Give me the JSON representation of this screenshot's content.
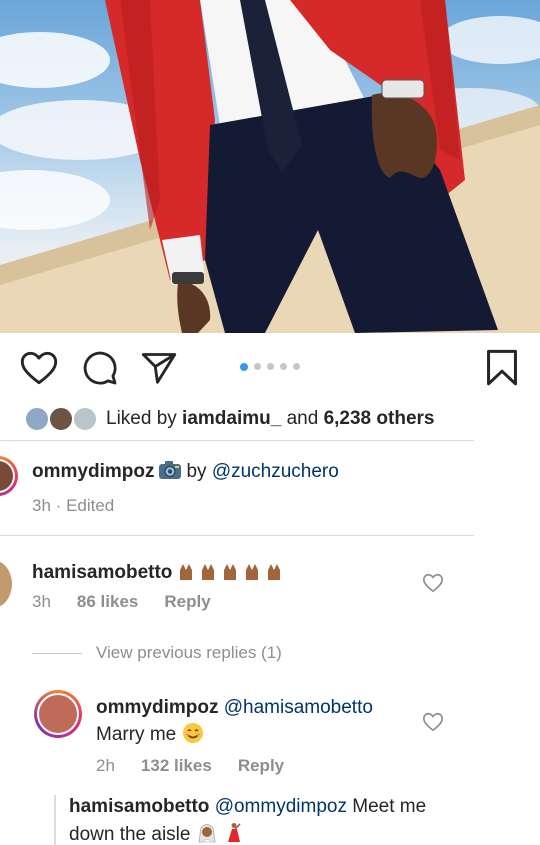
{
  "post": {
    "photo_alt": "",
    "carousel": {
      "count": 5,
      "active_index": 0
    }
  },
  "actions": {
    "like": "heart-icon",
    "comment": "comment-bubble-icon",
    "share": "paper-plane-icon",
    "save": "bookmark-icon"
  },
  "likes": {
    "prefix": "Liked by ",
    "first_user": "iamdaimu_",
    "middle": " and ",
    "others": "6,238 others"
  },
  "caption": {
    "username": "ommydimpoz",
    "camera_icon": "camera-emoji",
    "by_text": "by",
    "credit": "@zuchzuchero",
    "time": "3h",
    "separator": "·",
    "edited": "Edited"
  },
  "comments": [
    {
      "username": "hamisamobetto",
      "text": "🙌🏾🙌🏾🙌🏾🙌🏾🙌🏾",
      "time": "3h",
      "likes": "86 likes",
      "reply": "Reply"
    }
  ],
  "view_previous": "View previous replies (1)",
  "replies": [
    {
      "username": "ommydimpoz",
      "mention": "@hamisamobetto",
      "text": "Marry me",
      "time": "2h",
      "likes": "132 likes",
      "reply": "Reply"
    },
    {
      "username": "hamisamobetto",
      "mention": "@ommydimpoz",
      "text_line1": "Meet me",
      "text_line2": "down the aisle"
    }
  ],
  "colors": {
    "link": "#003569",
    "meta": "#8e8e8e",
    "dot_active": "#3897f0",
    "jacket": "#d62a2a"
  }
}
